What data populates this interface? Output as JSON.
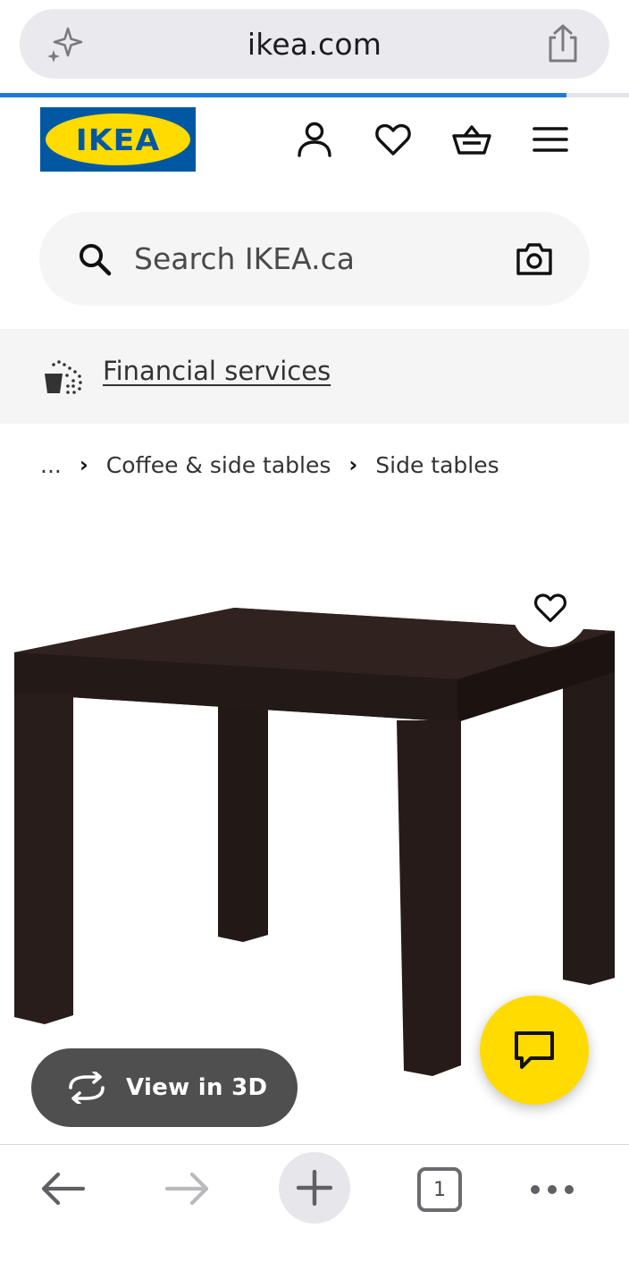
{
  "browser": {
    "url": "ikea.com",
    "load_progress": 0.9,
    "tab_count": "1"
  },
  "header": {
    "logo_text": "IKEA",
    "icons": [
      "account-icon",
      "heart-icon",
      "cart-icon",
      "menu-icon"
    ]
  },
  "search": {
    "placeholder": "Search IKEA.ca"
  },
  "promo": {
    "financial_services_label": "Financial services"
  },
  "breadcrumb": {
    "ellipsis": "...",
    "items": [
      "Coffee & side tables",
      "Side tables"
    ]
  },
  "product": {
    "view_3d_label": "View in 3D",
    "table_color": "#2b1f1c"
  },
  "colors": {
    "ikea_blue": "#0058a3",
    "ikea_yellow": "#ffdb00",
    "progress_blue": "#1f7ae0"
  }
}
